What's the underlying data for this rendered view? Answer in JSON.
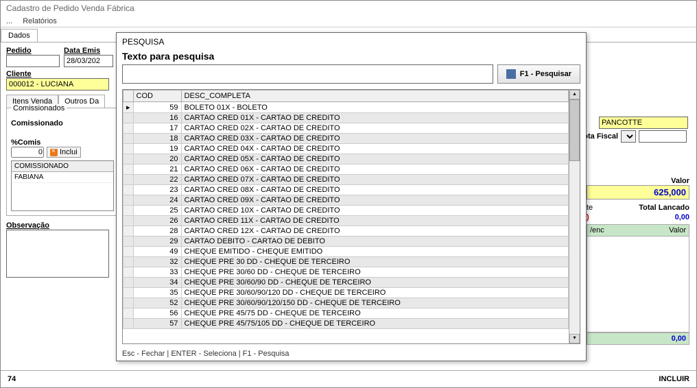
{
  "window": {
    "title": "Cadastro de Pedido Venda Fábrica"
  },
  "menu": {
    "dots": "...",
    "relatorios": "Relatórios"
  },
  "tabs": {
    "dados": "Dados"
  },
  "form": {
    "pedido_label": "Pedido",
    "pedido_value": "",
    "data_label": "Data Emis",
    "data_value": "28/03/202",
    "cliente_label": "Cliente",
    "cliente_value": "000012 - LUCIANA",
    "pancotte": "PANCOTTE",
    "nota_fiscal": "Nota Fiscal"
  },
  "subtabs": {
    "itens": "Itens Venda",
    "outros": "Outros Da"
  },
  "comis": {
    "box_title": "Comissionados",
    "label": "Comissionado",
    "pct_label": "%Comis",
    "pct_value": "0",
    "incluir_btn": "Inclui",
    "col": "COMISSIONADO",
    "row1": "FABIANA"
  },
  "obs": {
    "label": "Observação"
  },
  "right": {
    "valor_label": "Valor",
    "valor": "625,000",
    "te_label": "te",
    "total_label": "Total  Lancado",
    "total_red": ")",
    "total_blue": "0,00",
    "venc_label": "/enc",
    "valor2_label": "Valor",
    "green_total": "0,00"
  },
  "status": {
    "left": "74",
    "right": "INCLUIR"
  },
  "modal": {
    "title": "PESQUISA",
    "search_label": "Texto para pesquisa",
    "search_btn": "F1 - Pesquisar",
    "col_cod": "COD",
    "col_desc": "DESC_COMPLETA",
    "rows": [
      {
        "cod": "59",
        "desc": "BOLETO 01X - BOLETO"
      },
      {
        "cod": "16",
        "desc": "CARTAO CRED 01X - CARTAO DE CREDITO"
      },
      {
        "cod": "17",
        "desc": "CARTAO CRED 02X - CARTAO DE CREDITO"
      },
      {
        "cod": "18",
        "desc": "CARTAO CRED 03X - CARTAO DE CREDITO"
      },
      {
        "cod": "19",
        "desc": "CARTAO CRED 04X - CARTAO DE CREDITO"
      },
      {
        "cod": "20",
        "desc": "CARTAO CRED 05X - CARTAO DE CREDITO"
      },
      {
        "cod": "21",
        "desc": "CARTAO CRED 06X - CARTAO DE CREDITO"
      },
      {
        "cod": "22",
        "desc": "CARTAO CRED 07X - CARTAO DE CREDITO"
      },
      {
        "cod": "23",
        "desc": "CARTAO CRED 08X  - CARTAO DE CREDITO"
      },
      {
        "cod": "24",
        "desc": "CARTAO CRED 09X - CARTAO DE CREDITO"
      },
      {
        "cod": "25",
        "desc": "CARTAO CRED 10X - CARTAO DE CREDITO"
      },
      {
        "cod": "26",
        "desc": "CARTAO CRED 11X - CARTAO DE CREDITO"
      },
      {
        "cod": "28",
        "desc": "CARTAO CRED 12X - CARTAO DE CREDITO"
      },
      {
        "cod": "29",
        "desc": "CARTAO DEBITO - CARTAO DE DEBITO"
      },
      {
        "cod": "49",
        "desc": "CHEQUE EMITIDO - CHEQUE EMITIDO"
      },
      {
        "cod": "32",
        "desc": "CHEQUE PRE 30 DD - CHEQUE DE TERCEIRO"
      },
      {
        "cod": "33",
        "desc": "CHEQUE PRE 30/60 DD - CHEQUE DE TERCEIRO"
      },
      {
        "cod": "34",
        "desc": "CHEQUE PRE 30/60/90 DD - CHEQUE DE TERCEIRO"
      },
      {
        "cod": "35",
        "desc": "CHEQUE PRE 30/60/90/120 DD - CHEQUE DE TERCEIRO"
      },
      {
        "cod": "52",
        "desc": "CHEQUE PRE 30/60/90/120/150 DD - CHEQUE DE TERCEIRO"
      },
      {
        "cod": "56",
        "desc": "CHEQUE PRE 45/75 DD - CHEQUE DE TERCEIRO"
      },
      {
        "cod": "57",
        "desc": "CHEQUE PRE 45/75/105 DD - CHEQUE DE TERCEIRO"
      }
    ],
    "footer": "Esc - Fechar  |  ENTER - Seleciona  |  F1 - Pesquisa"
  }
}
